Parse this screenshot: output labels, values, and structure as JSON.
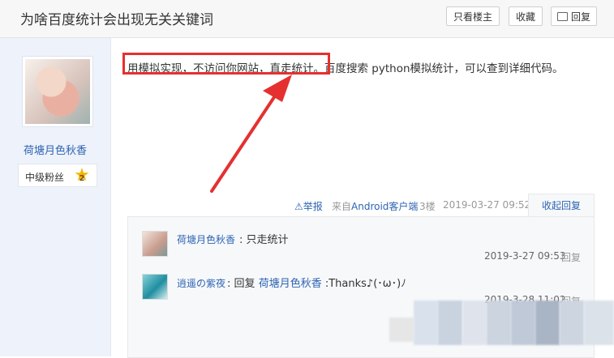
{
  "header": {
    "title": "为啥百度统计会出现无关关键词",
    "buttons": {
      "only_op": "只看楼主",
      "favorite": "收藏",
      "reply": "回复"
    }
  },
  "author": {
    "name": "荷塘月色秋香",
    "level_label": "中级粉丝",
    "level_number": "2"
  },
  "post": {
    "highlighted_text": "用模拟实现，不访问你网站，直走统计。",
    "rest_text": "百度搜索 python模拟统计，可以查到详细代码。",
    "report": "举报",
    "from_prefix": "来自",
    "from_client": "Android客户端",
    "floor": "3楼",
    "time": "2019-03-27 09:52",
    "collapse_label": "收起回复"
  },
  "comments": [
    {
      "user": "荷塘月色秋香",
      "separator": ":",
      "text": "只走统计",
      "time": "2019-3-27 09:53",
      "reply": "回复"
    },
    {
      "user": "逍遥の紫夜",
      "separator": ":",
      "text_prefix": "回复",
      "mention": "荷塘月色秋香",
      "text": ":Thanks♪(･ω･)ﾉ",
      "time": "2019-3-28 11:02",
      "reply": "回复"
    }
  ],
  "colors": {
    "link": "#2d64b3",
    "annotation": "#e53030",
    "sidebar_bg": "#eef2fb"
  },
  "icons": [
    "report-warning-icon",
    "reply-icon",
    "level-star-icon"
  ]
}
